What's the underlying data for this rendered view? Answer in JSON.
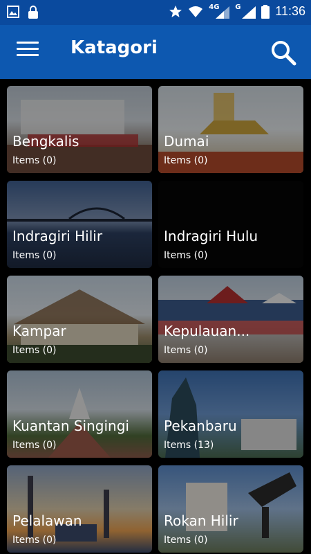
{
  "status_bar": {
    "time": "11:36",
    "network_4g": "4G",
    "network_g": "G"
  },
  "app_bar": {
    "title": "Katagori"
  },
  "categories": [
    {
      "name": "Bengkalis",
      "items": "Items (0)"
    },
    {
      "name": "Dumai",
      "items": "Items (0)"
    },
    {
      "name": "Indragiri Hilir",
      "items": "Items (0)"
    },
    {
      "name": "Indragiri Hulu",
      "items": "Items (0)"
    },
    {
      "name": "Kampar",
      "items": "Items (0)"
    },
    {
      "name": "Kepulauan...",
      "items": "Items (0)"
    },
    {
      "name": "Kuantan Singingi",
      "items": "Items (0)"
    },
    {
      "name": "Pekanbaru",
      "items": "Items (13)"
    },
    {
      "name": "Pelalawan",
      "items": "Items (0)"
    },
    {
      "name": "Rokan Hilir",
      "items": "Items (0)"
    }
  ]
}
